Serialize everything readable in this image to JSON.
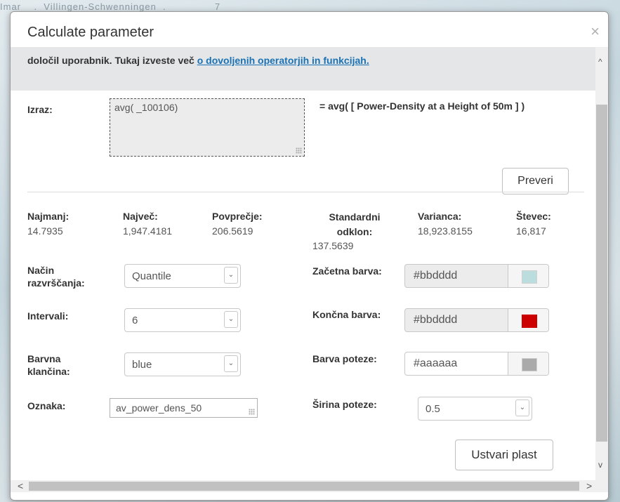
{
  "background": {
    "map_text": "Imar    .  Villingen-Schwenningen  .               7"
  },
  "dialog": {
    "title": "Calculate parameter",
    "close_glyph": "×"
  },
  "info": {
    "text": "določil uporabnik. Tukaj izveste več ",
    "link": "o dovoljenih operatorjih in funkcijah."
  },
  "expression": {
    "label": "Izraz:",
    "value": "avg( _100106)",
    "formula": "= avg( [ Power-Density at a Height of 50m ] )",
    "check_button": "Preveri"
  },
  "stats": [
    {
      "label": "Najmanj:",
      "value": "14.7935"
    },
    {
      "label": "Največ:",
      "value": "1,947.4181"
    },
    {
      "label": "Povprečje:",
      "value": "206.5619"
    },
    {
      "label": "Standardni odklon:",
      "value": "137.5639"
    },
    {
      "label": "Varianca:",
      "value": "18,923.8155"
    },
    {
      "label": "Števec:",
      "value": "16,817"
    }
  ],
  "form": {
    "classification": {
      "label": "Način razvrščanja:",
      "value": "Quantile"
    },
    "intervals": {
      "label": "Intervali:",
      "value": "6"
    },
    "ramp": {
      "label": "Barvna klančina:",
      "value": "blue"
    },
    "name": {
      "label": "Oznaka:",
      "value": "av_power_dens_50"
    },
    "start_color": {
      "label": "Začetna barva:",
      "value": "#bbdddd",
      "swatch": "#bbdddd"
    },
    "end_color": {
      "label": "Končna barva:",
      "value": "#bbdddd",
      "swatch": "#cc0000"
    },
    "stroke_color": {
      "label": "Barva poteze:",
      "value": "#aaaaaa",
      "swatch": "#aaaaaa"
    },
    "stroke_width": {
      "label": "Širina poteze:",
      "value": "0.5"
    },
    "create_button": "Ustvari plast"
  },
  "scrollbars": {
    "up": "^",
    "down": "v",
    "left": "<",
    "right": ">"
  }
}
